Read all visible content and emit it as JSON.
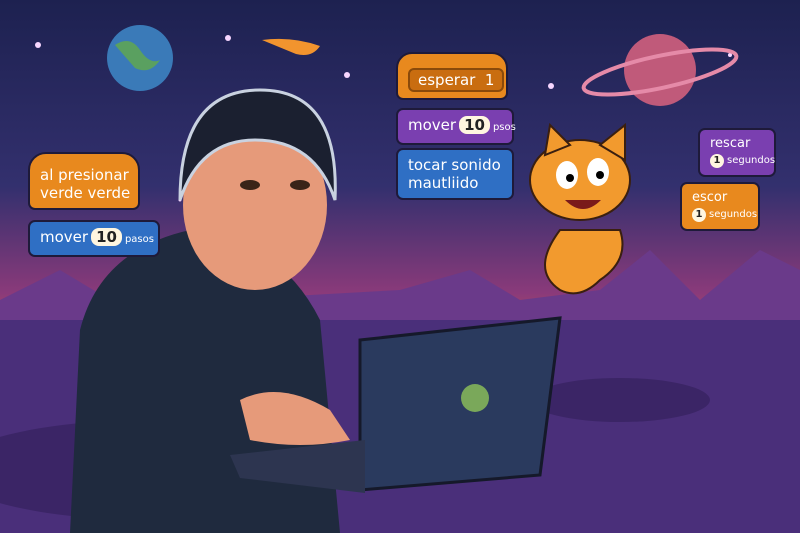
{
  "colors": {
    "sky_top": "#1d2150",
    "sky_horizon": "#e0623a",
    "ground": "#4a2f7a",
    "block_orange": "#e8891e",
    "block_purple": "#7a3fb0",
    "block_blue": "#2f6fc4",
    "cat": "#f29a2e"
  },
  "blocks": {
    "left_hat": {
      "text_line1": "al presionar",
      "text_line2": "verde verde"
    },
    "left_move": {
      "verb": "mover",
      "number": "10",
      "unit": "pasos"
    },
    "center_wait": {
      "verb": "esperar",
      "number": "1"
    },
    "center_move": {
      "verb": "mover",
      "number": "10",
      "unit": "psos"
    },
    "center_sound": {
      "text_line1": "tocar sonido",
      "text_line2": "mautliido"
    },
    "right_purple": {
      "verb": "rescar",
      "number": "1",
      "unit": "segundos"
    },
    "right_orange": {
      "verb": "escor",
      "number": "1",
      "unit": "segundos"
    }
  }
}
